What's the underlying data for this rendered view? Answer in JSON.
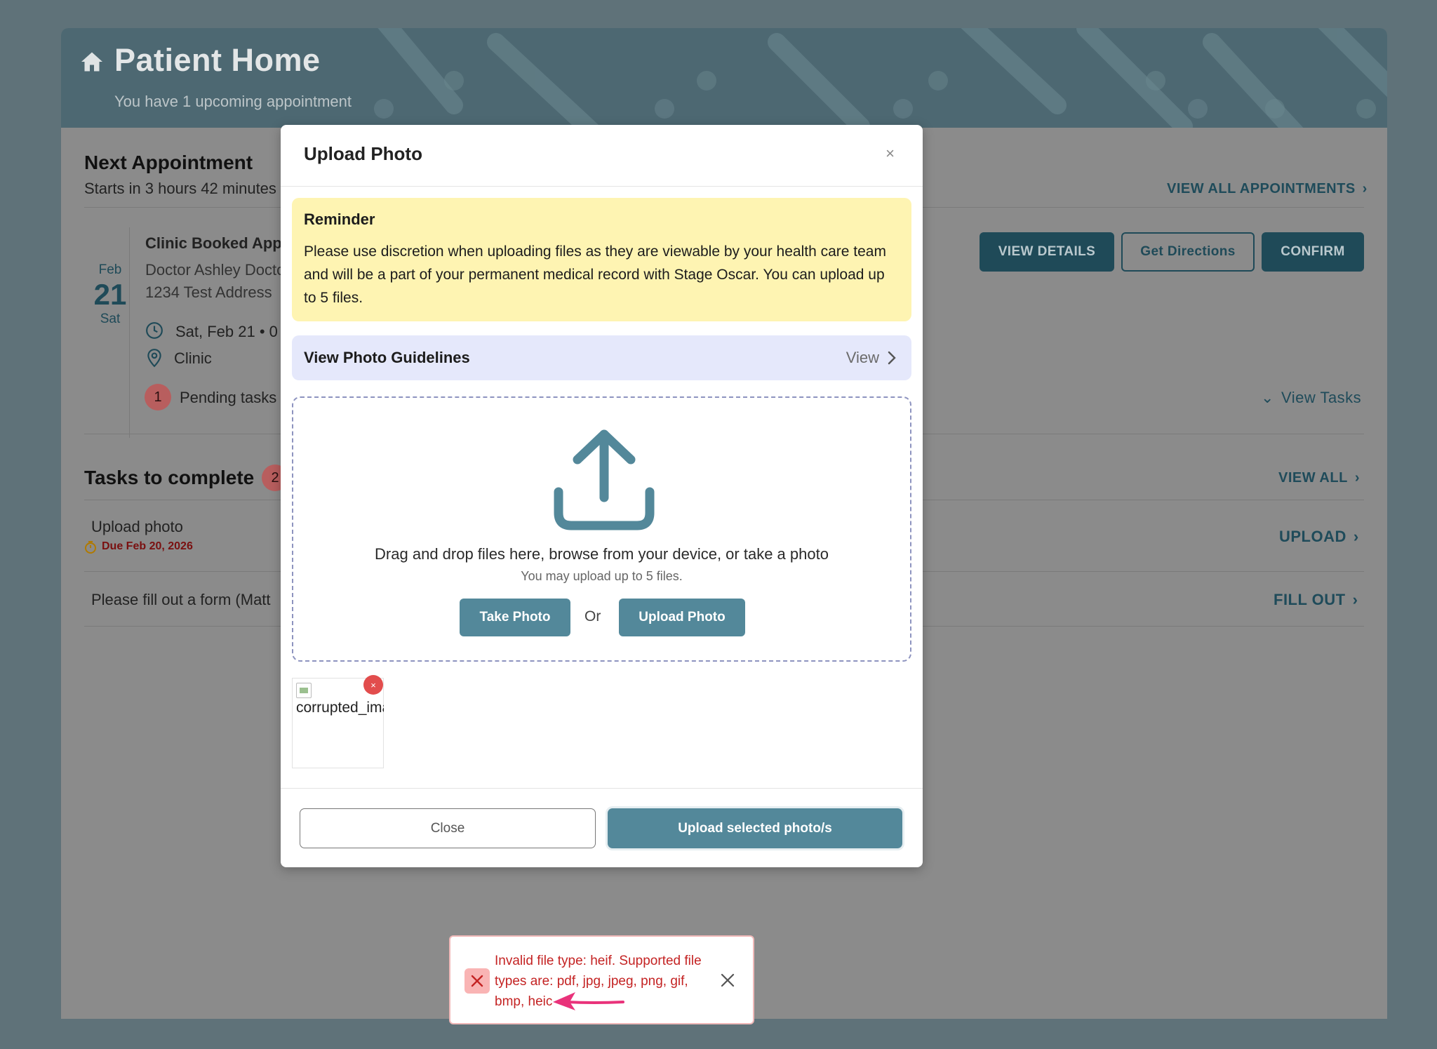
{
  "header": {
    "title": "Patient Home",
    "subtitle": "You have 1 upcoming appointment"
  },
  "next_appointment": {
    "heading": "Next Appointment",
    "starts_in": "Starts in 3 hours 42 minutes",
    "view_all_label": "VIEW ALL APPOINTMENTS",
    "date": {
      "month": "Feb",
      "day": "21",
      "weekday": "Sat"
    },
    "title": "Clinic Booked Appointment",
    "doctor": "Doctor Ashley Doctor",
    "address": "1234 Test Address",
    "when": "Sat, Feb 21 • 0",
    "location_type": "Clinic",
    "pending_count": "1",
    "pending_label": "Pending tasks",
    "view_tasks_label": "View Tasks",
    "buttons": {
      "view_details": "VIEW DETAILS",
      "directions": "Get Directions",
      "confirm": "CONFIRM"
    }
  },
  "tasks": {
    "heading": "Tasks to complete",
    "count": "2",
    "view_all_label": "VIEW ALL",
    "items": [
      {
        "title": "Upload photo",
        "due": "Due Feb 20, 2026",
        "action": "UPLOAD"
      },
      {
        "title": "Please fill out a form (Matt",
        "due": "",
        "action": "FILL OUT"
      }
    ]
  },
  "modal": {
    "title": "Upload Photo",
    "close_glyph": "×",
    "reminder_title": "Reminder",
    "reminder_body": "Please use discretion when uploading files as they are viewable by your health care team and will be a part of your permanent medical record with Stage Oscar. You can upload up to 5 files.",
    "guidelines_label": "View Photo Guidelines",
    "guidelines_action": "View",
    "dropzone_text": "Drag and drop files here, browse from your device, or take a photo",
    "dropzone_subtext": "You may upload up to 5 files.",
    "take_photo_label": "Take Photo",
    "or_label": "Or",
    "upload_photo_label": "Upload Photo",
    "file_name": "corrupted_image.heif",
    "remove_glyph": "×",
    "close_label": "Close",
    "submit_label": "Upload selected photo/s"
  },
  "toast": {
    "message": "Invalid file type: heif. Supported file types are: pdf, jpg, jpeg, png, gif, bmp, heic"
  },
  "colors": {
    "primary": "#53889a",
    "dark_primary": "#1f4a58",
    "reminder_bg": "#fef4b2",
    "guidelines_bg": "#e5e8fb",
    "error": "#c42323",
    "annotation": "#e9327a"
  }
}
